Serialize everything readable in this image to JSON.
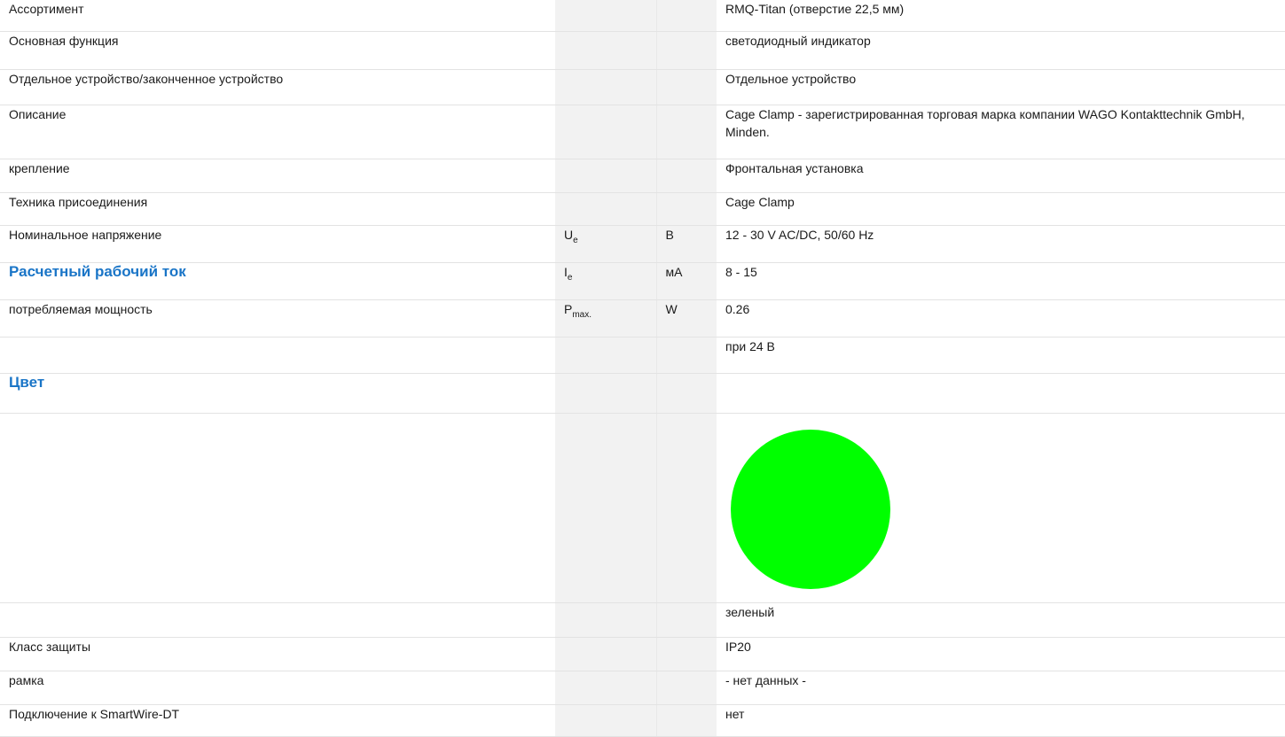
{
  "rows": [
    {
      "label": "Ассортимент",
      "symbol": "",
      "symbol_sub": "",
      "unit": "",
      "value": "RMQ-Titan (отверстие 22,5 мм)"
    },
    {
      "label": "Основная функция",
      "symbol": "",
      "symbol_sub": "",
      "unit": "",
      "value": "светодиодный индикатор"
    },
    {
      "label": "Отдельное устройство/законченное устройство",
      "symbol": "",
      "symbol_sub": "",
      "unit": "",
      "value": "Отдельное устройство"
    },
    {
      "label": "Описание",
      "symbol": "",
      "symbol_sub": "",
      "unit": "",
      "value": "Cage Clamp - зарегистрированная торговая марка компании WAGO Kontakttechnik GmbH, Minden."
    },
    {
      "label": "крепление",
      "symbol": "",
      "symbol_sub": "",
      "unit": "",
      "value": "Фронтальная установка"
    },
    {
      "label": "Техника присоединения",
      "symbol": "",
      "symbol_sub": "",
      "unit": "",
      "value": "Cage Clamp"
    },
    {
      "label": "Номинальное напряжение",
      "symbol": "U",
      "symbol_sub": "e",
      "unit": "В",
      "value": "12 - 30 V AC/DC, 50/60 Hz"
    },
    {
      "label": "Расчетный рабочий ток",
      "symbol": "I",
      "symbol_sub": "e",
      "unit": "мА",
      "value": "8 - 15"
    },
    {
      "label": "потребляемая мощность",
      "symbol": "P",
      "symbol_sub": "max.",
      "unit": "W",
      "value": "0.26"
    },
    {
      "label": "",
      "symbol": "",
      "symbol_sub": "",
      "unit": "",
      "value": "при 24 В"
    },
    {
      "label": "Цвет",
      "symbol": "",
      "symbol_sub": "",
      "unit": "",
      "value": ""
    },
    {
      "label": "",
      "symbol": "",
      "symbol_sub": "",
      "unit": "",
      "value": "зеленый"
    },
    {
      "label": "Класс защиты",
      "symbol": "",
      "symbol_sub": "",
      "unit": "",
      "value": "IP20"
    },
    {
      "label": "рамка",
      "symbol": "",
      "symbol_sub": "",
      "unit": "",
      "value": "- нет данных -"
    },
    {
      "label": "Подключение к SmartWire-DT",
      "symbol": "",
      "symbol_sub": "",
      "unit": "",
      "value": "нет"
    }
  ],
  "color_swatch": {
    "fill": "#00ff00"
  },
  "colors": {
    "accent_heading": "#1a75c7",
    "column_shade": "#f2f2f2"
  }
}
